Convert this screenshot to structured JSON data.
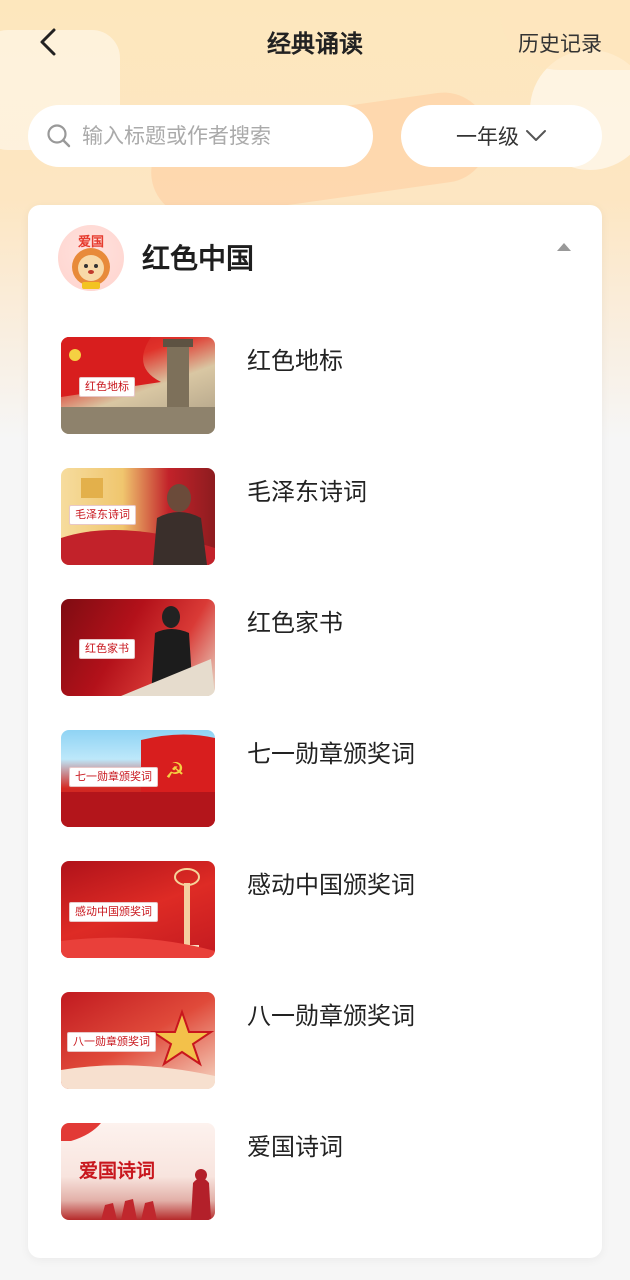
{
  "nav": {
    "title": "经典诵读",
    "history_label": "历史记录"
  },
  "search": {
    "placeholder": "输入标题或作者搜索",
    "value": ""
  },
  "grade": {
    "selected": "一年级"
  },
  "category": {
    "title": "红色中国",
    "avatar_text": "爱国",
    "expanded": true,
    "items": [
      {
        "title": "红色地标",
        "thumb_label": "红色地标"
      },
      {
        "title": "毛泽东诗词",
        "thumb_label": "毛泽东诗词"
      },
      {
        "title": "红色家书",
        "thumb_label": "红色家书"
      },
      {
        "title": "七一勋章颁奖词",
        "thumb_label": "七一勋章颁奖词"
      },
      {
        "title": "感动中国颁奖词",
        "thumb_label": "感动中国颁奖词"
      },
      {
        "title": "八一勋章颁奖词",
        "thumb_label": "八一勋章颁奖词"
      },
      {
        "title": "爱国诗词",
        "thumb_label": "爱国诗词"
      }
    ]
  },
  "colors": {
    "accent_red": "#c8161d",
    "header_bg": "#fde7bd",
    "page_bg": "#f6f6f6"
  }
}
